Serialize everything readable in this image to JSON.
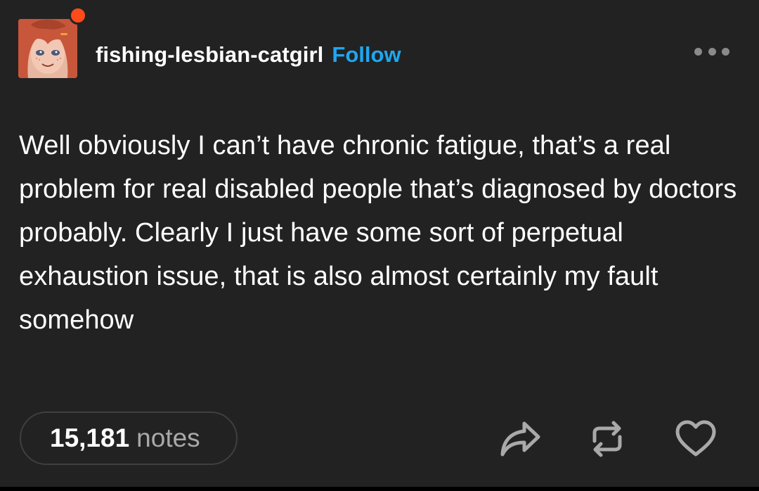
{
  "post": {
    "blog_name": "fishing-lesbian-catgirl",
    "follow_label": "Follow",
    "body": "Well obviously I can’t have chronic fatigue, that’s a real problem for real disabled people that’s diagnosed by doctors probably. Clearly I just have some sort of perpetual exhaustion issue, that is also almost certainly my fault somehow",
    "notes_count": "15,181",
    "notes_label": "notes"
  },
  "icons": {
    "avatar_badge": "notification-dot",
    "menu": "more-options-icon",
    "share": "share-icon",
    "reblog": "reblog-icon",
    "like": "heart-icon"
  },
  "colors": {
    "background": "#222222",
    "text": "#ffffff",
    "follow": "#1ea7f1",
    "muted": "#a9a9a9",
    "badge": "#ff4a1c"
  }
}
